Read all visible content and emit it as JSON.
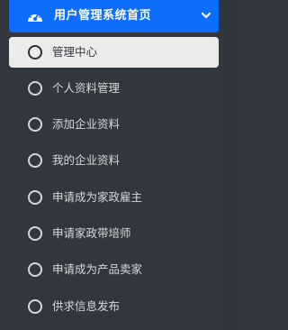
{
  "sidebar": {
    "header": {
      "title": "用户管理系统首页",
      "icon": "dashboard-gauge-icon",
      "chevron": "chevron-down-icon"
    },
    "items": [
      {
        "label": "管理中心",
        "active": true
      },
      {
        "label": "个人资料管理",
        "active": false
      },
      {
        "label": "添加企业资料",
        "active": false
      },
      {
        "label": "我的企业资料",
        "active": false
      },
      {
        "label": "申请成为家政雇主",
        "active": false
      },
      {
        "label": "申请家政带培师",
        "active": false
      },
      {
        "label": "申请成为产品卖家",
        "active": false
      },
      {
        "label": "供求信息发布",
        "active": false
      }
    ]
  },
  "colors": {
    "accent": "#0d6efd",
    "background": "#32373f",
    "active_bg": "#ebebeb",
    "text": "#d7d8da"
  }
}
